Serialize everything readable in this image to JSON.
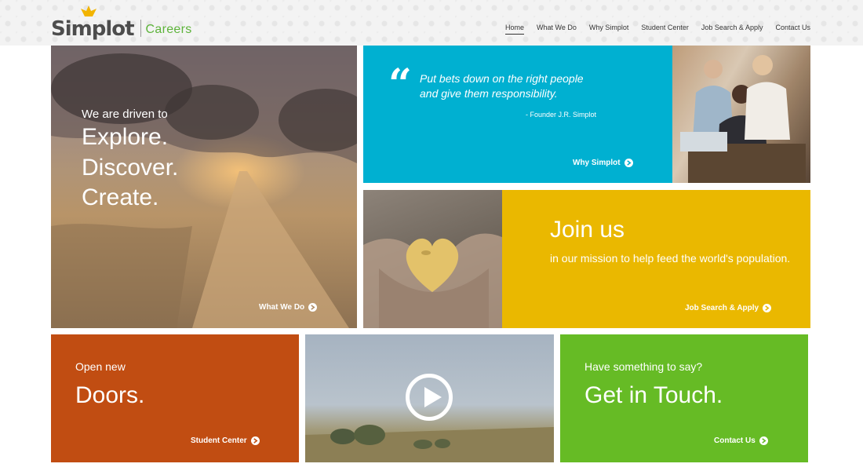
{
  "brand": {
    "name": "Simplot",
    "section": "Careers"
  },
  "nav": {
    "home": "Home",
    "what_we_do": "What We Do",
    "why_simplot": "Why Simplot",
    "student_center": "Student Center",
    "job_search": "Job Search & Apply",
    "contact_us": "Contact Us"
  },
  "hero": {
    "intro": "We are driven to",
    "words": [
      "Explore.",
      "Discover.",
      "Create."
    ],
    "cta": "What We Do"
  },
  "quote": {
    "text": "Put bets down on the right people and give them responsibility.",
    "author": "- Founder J.R. Simplot",
    "cta": "Why Simplot"
  },
  "join": {
    "title": "Join us",
    "subtitle": "in our mission to help feed the world's population.",
    "cta": "Job Search & Apply"
  },
  "doors": {
    "small": "Open new",
    "big": "Doors.",
    "cta": "Student Center"
  },
  "touch": {
    "small": "Have something to say?",
    "big": "Get in Touch.",
    "cta": "Contact Us"
  },
  "colors": {
    "quote": "#00b0d1",
    "join": "#eab800",
    "doors": "#c14d12",
    "touch": "#66bb25",
    "careers_green": "#5db33a"
  },
  "icons": {
    "cta_arrow": "circle-arrow-right-icon",
    "play": "play-icon",
    "quote_mark": "quote-icon",
    "logo_leaf": "leaf-icon"
  }
}
